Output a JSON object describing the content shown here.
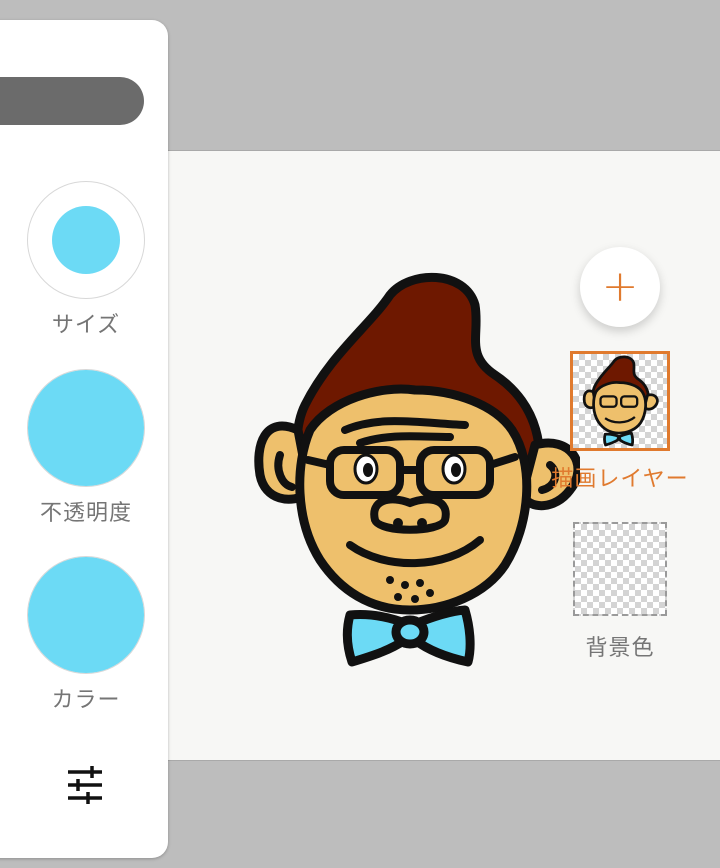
{
  "tools": {
    "size_label": "サイズ",
    "opacity_label": "不透明度",
    "color_label": "カラー"
  },
  "settings_icon": "sliders-icon",
  "add_layer_icon": "plus-icon",
  "layers": {
    "drawing_label": "描画レイヤー",
    "background_label": "背景色"
  },
  "colors": {
    "accent": "#e07a2e",
    "brush": "#6cdaf5",
    "panel_pill": "#6b6b6b",
    "canvas": "#f7f7f5",
    "workspace": "#bdbdbd"
  }
}
